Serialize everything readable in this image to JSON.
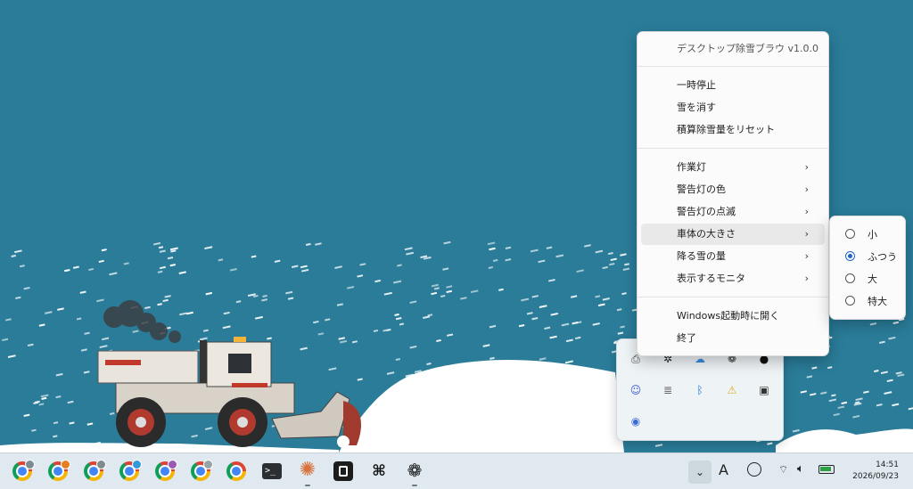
{
  "menu": {
    "title": "デスクトップ除雪ブラウ v1.0.0",
    "items_group1": [
      "一時停止",
      "雪を消す",
      "積算除雪量をリセット"
    ],
    "items_group2": [
      "作業灯",
      "警告灯の色",
      "警告灯の点滅",
      "車体の大きさ",
      "降る雪の量",
      "表示するモニタ"
    ],
    "items_group3": [
      "Windows起動時に開く",
      "終了"
    ],
    "highlighted": "車体の大きさ"
  },
  "submenu": {
    "options": [
      "小",
      "ふつう",
      "大",
      "特大"
    ],
    "selected": "ふつう"
  },
  "tray_flyout": {
    "icons": [
      "printer-icon",
      "pinwheel-icon",
      "cloud-icon",
      "chatgpt-icon",
      "github-icon",
      "people-icon",
      "stack-icon",
      "bluetooth-icon",
      "shield-warning-icon",
      "drive-icon",
      "remote-icon"
    ]
  },
  "taskbar": {
    "apps": [
      "chrome-icon",
      "chrome-icon",
      "chrome-icon",
      "chrome-icon",
      "chrome-icon",
      "chrome-icon",
      "chrome-icon",
      "terminal-icon",
      "claude-icon",
      "window-icon",
      "capcut-icon",
      "chatgpt-icon"
    ],
    "ime": "A",
    "time": "14:51",
    "date": "2026/09/23"
  },
  "colors": {
    "sky": "#2a7c99",
    "snow": "#ffffff",
    "accent": "#1f62c9",
    "taskbar": "#dfe9ef"
  }
}
